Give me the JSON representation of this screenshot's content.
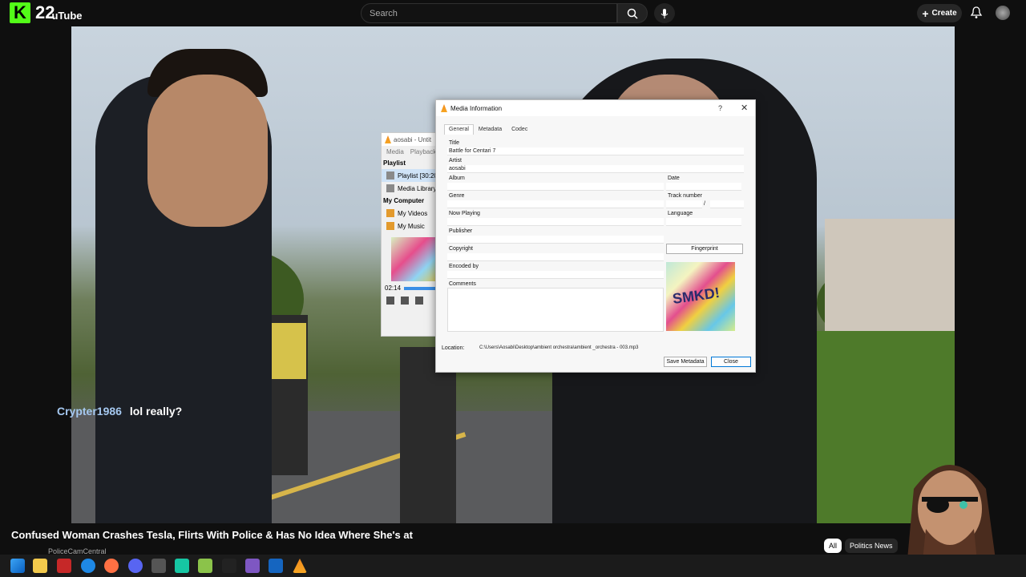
{
  "header": {
    "kick_logo": "K",
    "channel_number": "22",
    "youtube_text": "uTube",
    "search_placeholder": "Search",
    "create_label": "Create"
  },
  "chat": {
    "username": "Crypter1986",
    "message": "lol really?"
  },
  "video_info": {
    "title": "Confused Woman Crashes Tesla, Flirts With Police & Has No Idea Where She's at",
    "channel": "PoliceCamCentral"
  },
  "chips": [
    {
      "label": "All"
    },
    {
      "label": "Politics News"
    }
  ],
  "vlc_player": {
    "title": "aosabi - Untit",
    "menu": [
      "Media",
      "Playback"
    ],
    "playlist_header": "Playlist",
    "playlist_item": "Playlist [30:20",
    "media_library": "Media Library",
    "my_computer": "My Computer",
    "my_videos": "My Videos",
    "my_music": "My Music",
    "time": "02:14"
  },
  "media_info": {
    "window_title": "Media Information",
    "help": "?",
    "close_x": "✕",
    "tabs": [
      "General",
      "Metadata",
      "Codec"
    ],
    "labels": {
      "title": "Title",
      "artist": "Artist",
      "album": "Album",
      "date": "Date",
      "genre": "Genre",
      "track_number": "Track number",
      "now_playing": "Now Playing",
      "language": "Language",
      "publisher": "Publisher",
      "copyright": "Copyright",
      "encoded_by": "Encoded by",
      "comments": "Comments",
      "location": "Location:"
    },
    "values": {
      "title": "Battle for Centari 7",
      "artist": "aosabi",
      "track_separator": "/",
      "location": "C:\\Users\\Aosabi\\Desktop\\ambient orchestra\\ambient _orchestra - 003.mp3"
    },
    "buttons": {
      "fingerprint": "Fingerprint",
      "save_metadata": "Save Metadata",
      "close": "Close"
    }
  }
}
